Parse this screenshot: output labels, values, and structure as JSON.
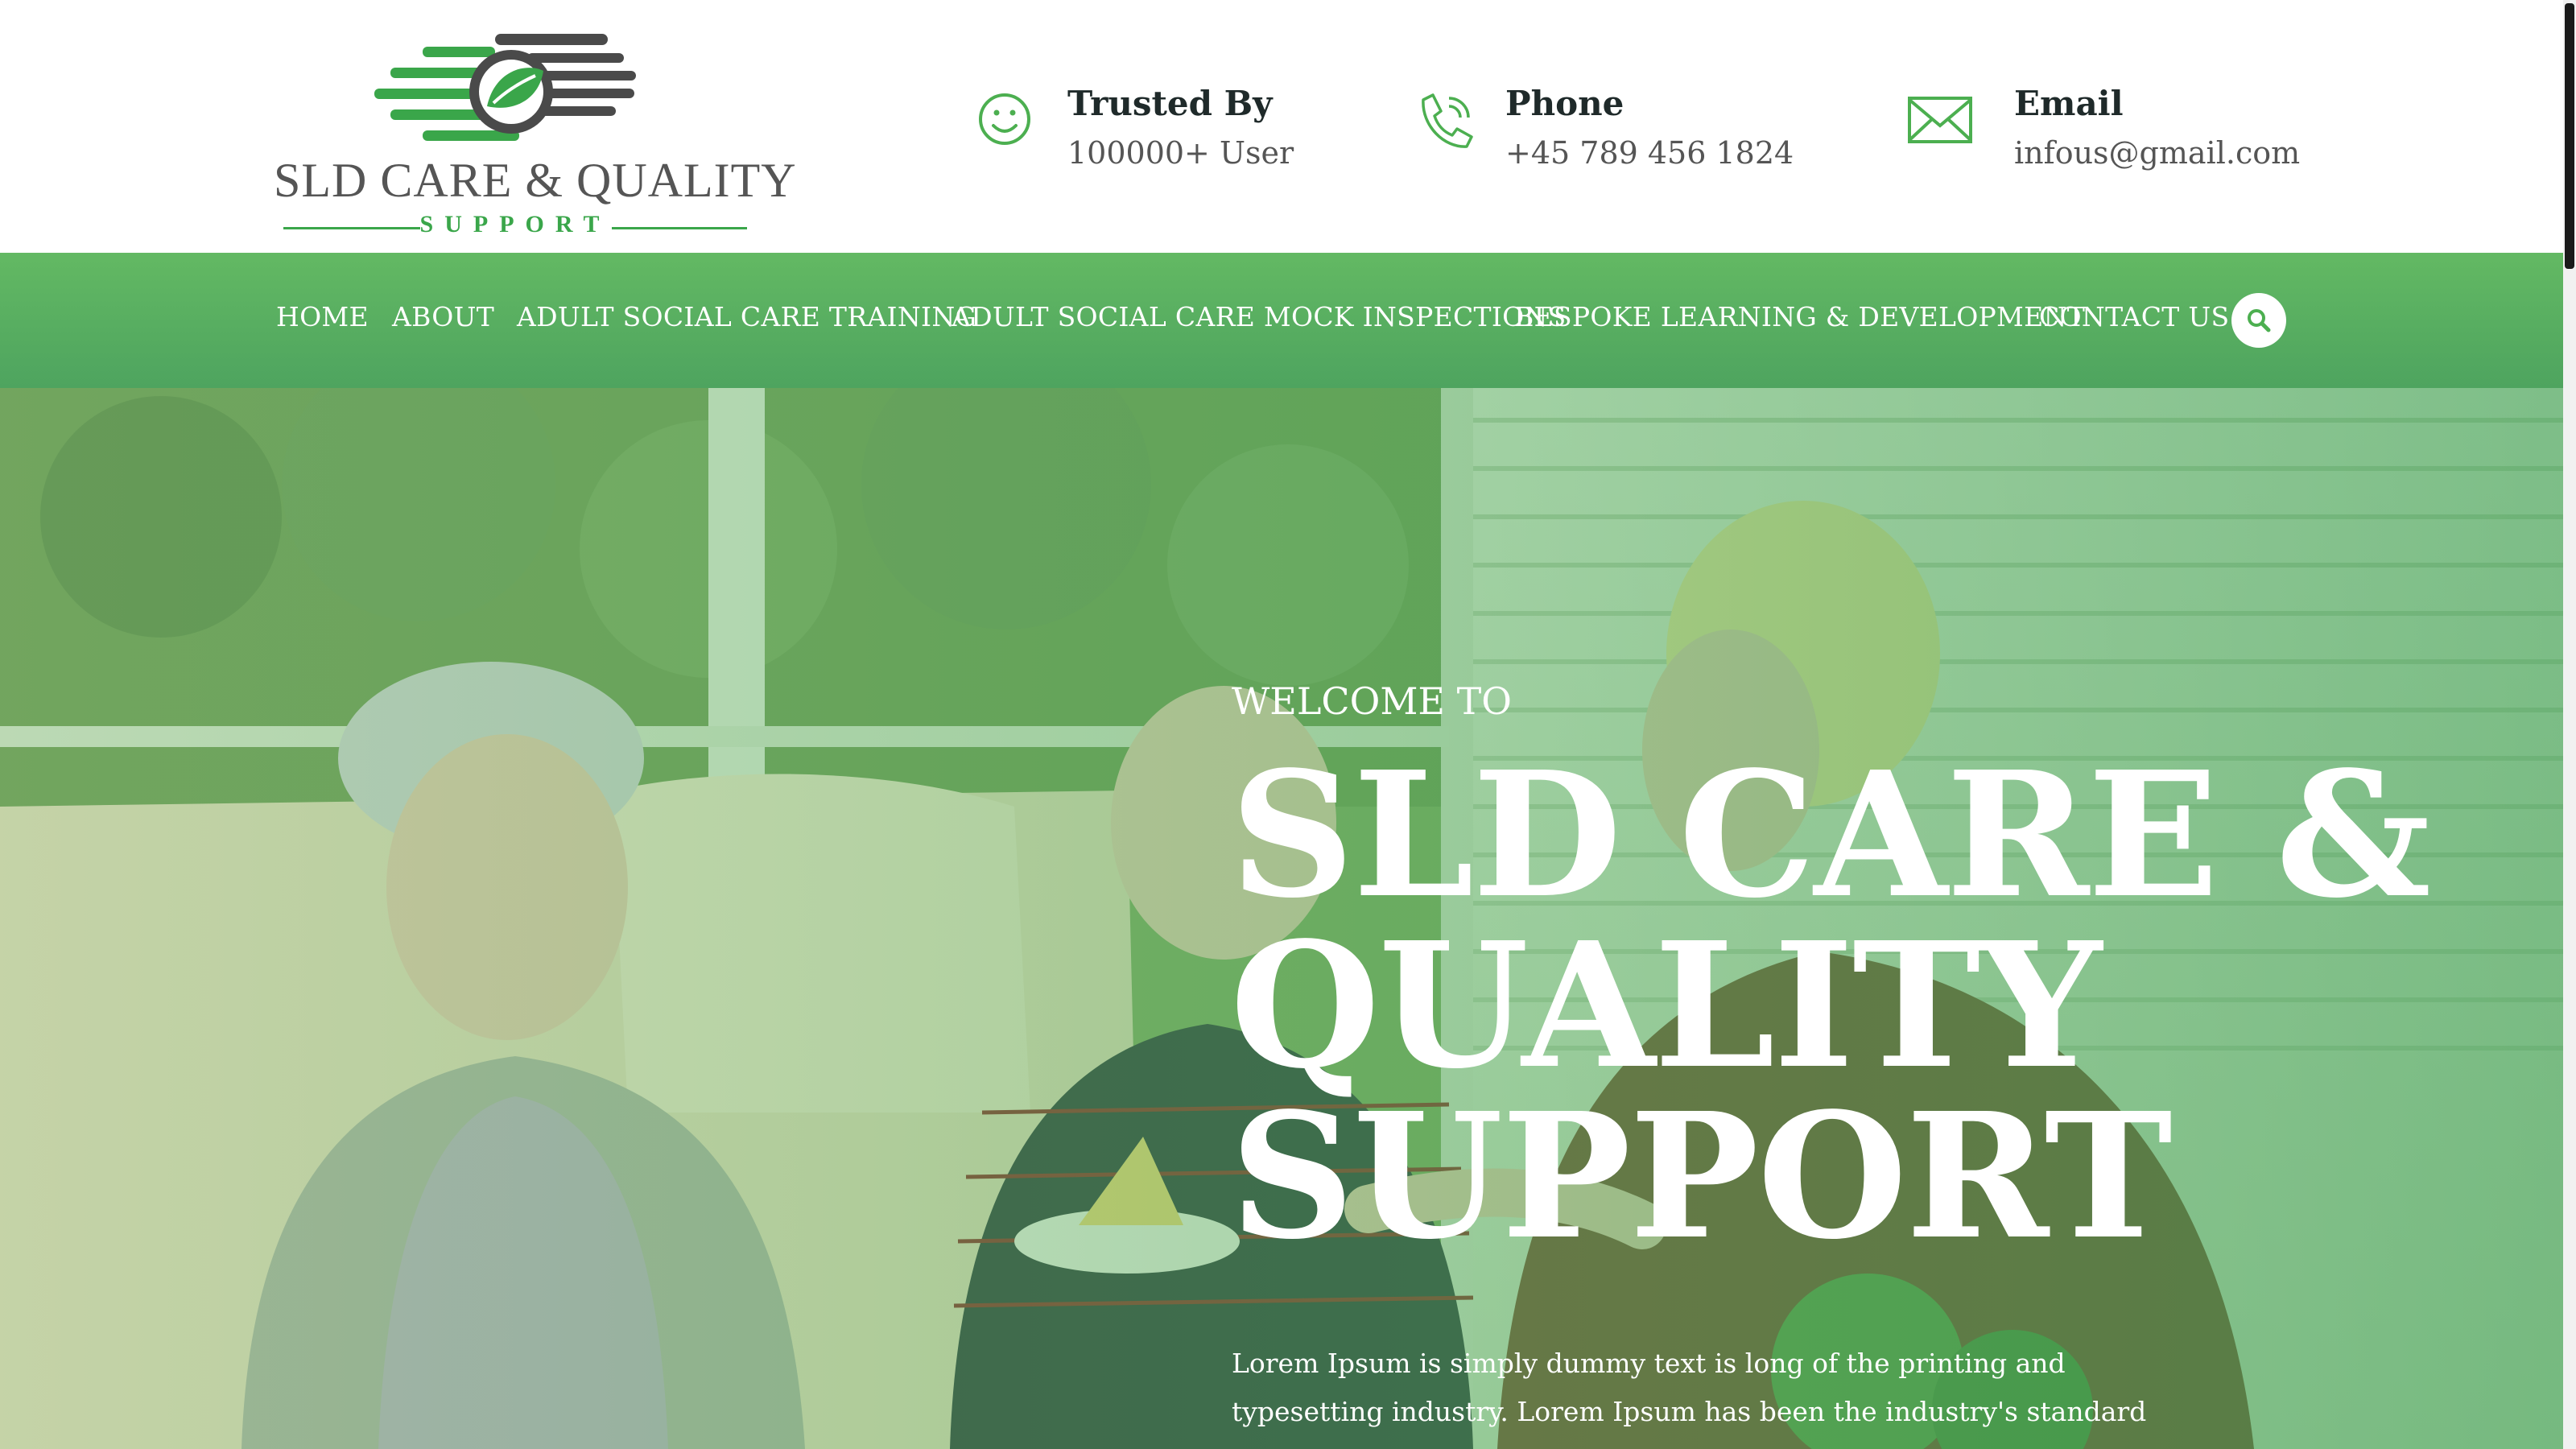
{
  "logo": {
    "brand": "SLD CARE & QUALITY",
    "tagline": "SUPPORT",
    "colors": {
      "green": "#3aa64a",
      "gray": "#555555"
    }
  },
  "contact": {
    "trusted": {
      "label": "Trusted By",
      "value": "100000+ User",
      "icon": "smiley-icon"
    },
    "phone": {
      "label": "Phone",
      "value": "+45 789 456 1824",
      "icon": "phone-icon"
    },
    "email": {
      "label": "Email",
      "value": "infous@gmail.com",
      "icon": "envelope-icon"
    }
  },
  "nav": {
    "items": [
      {
        "label": "HOME"
      },
      {
        "label": "ABOUT"
      },
      {
        "label": "ADULT SOCIAL CARE TRAINING"
      },
      {
        "label": "ADULT SOCIAL CARE MOCK INSPECTIONS"
      },
      {
        "label": "BESPOKE LEARNING & DEVELOPMENT"
      },
      {
        "label": "CONTACT US"
      }
    ],
    "search_icon": "search-icon",
    "color": "#5cb25f"
  },
  "hero": {
    "kicker": "WELCOME TO",
    "title_lines": [
      "SLD CARE &",
      "QUALITY",
      "SUPPORT"
    ],
    "description": "Lorem Ipsum is simply dummy text is long of the printing and typesetting industry. Lorem Ipsum has been the industry's standard dumy text ever",
    "overlay_color": "#4caf50"
  }
}
